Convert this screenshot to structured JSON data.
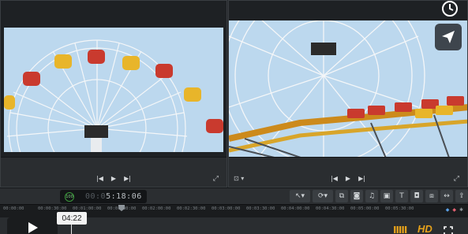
{
  "viewers": {
    "left": {
      "prev": "|◀",
      "play": "▶",
      "next": "▶|",
      "fullscreen": "⤢"
    },
    "right": {
      "zoom": "⊡ ▾",
      "prev": "|◀",
      "play": "▶",
      "next": "▶|",
      "fullscreen": "⤢"
    }
  },
  "toolbar": {
    "timecode_dim": "00:0",
    "timecode_main": "5:18:06",
    "indicator": "100",
    "tools": [
      {
        "name": "pointer-tool",
        "label": "↖▾"
      },
      {
        "name": "link-tool",
        "label": "⟳▾"
      },
      {
        "name": "copy-tool",
        "label": "⧉"
      },
      {
        "name": "snapshot-tool",
        "label": "◙"
      },
      {
        "name": "audio-tool",
        "label": "♫"
      },
      {
        "name": "media-tool",
        "label": "▣"
      },
      {
        "name": "title-tool",
        "label": "T"
      },
      {
        "name": "effects-tool",
        "label": "◘"
      },
      {
        "name": "overlay-tool",
        "label": "⧈"
      },
      {
        "name": "split-tool",
        "label": "↔"
      },
      {
        "name": "export-tool",
        "label": "⇪"
      }
    ]
  },
  "ruler": {
    "ticks": [
      "00:00:00",
      "00:00:30:00",
      "00:01:00:00",
      "00:01:30:00",
      "00:02:00:00",
      "00:02:30:00",
      "00:03:00:00",
      "00:03:30:00",
      "00:04:00:00",
      "00:04:30:00",
      "00:05:00:00",
      "00:05:30:00"
    ]
  },
  "player": {
    "current_time": "04:22",
    "hd_label": "HD",
    "bars_label": "IIIII"
  },
  "colors": {
    "accent": "#e7a21b",
    "sky": "#b9d6ec"
  }
}
